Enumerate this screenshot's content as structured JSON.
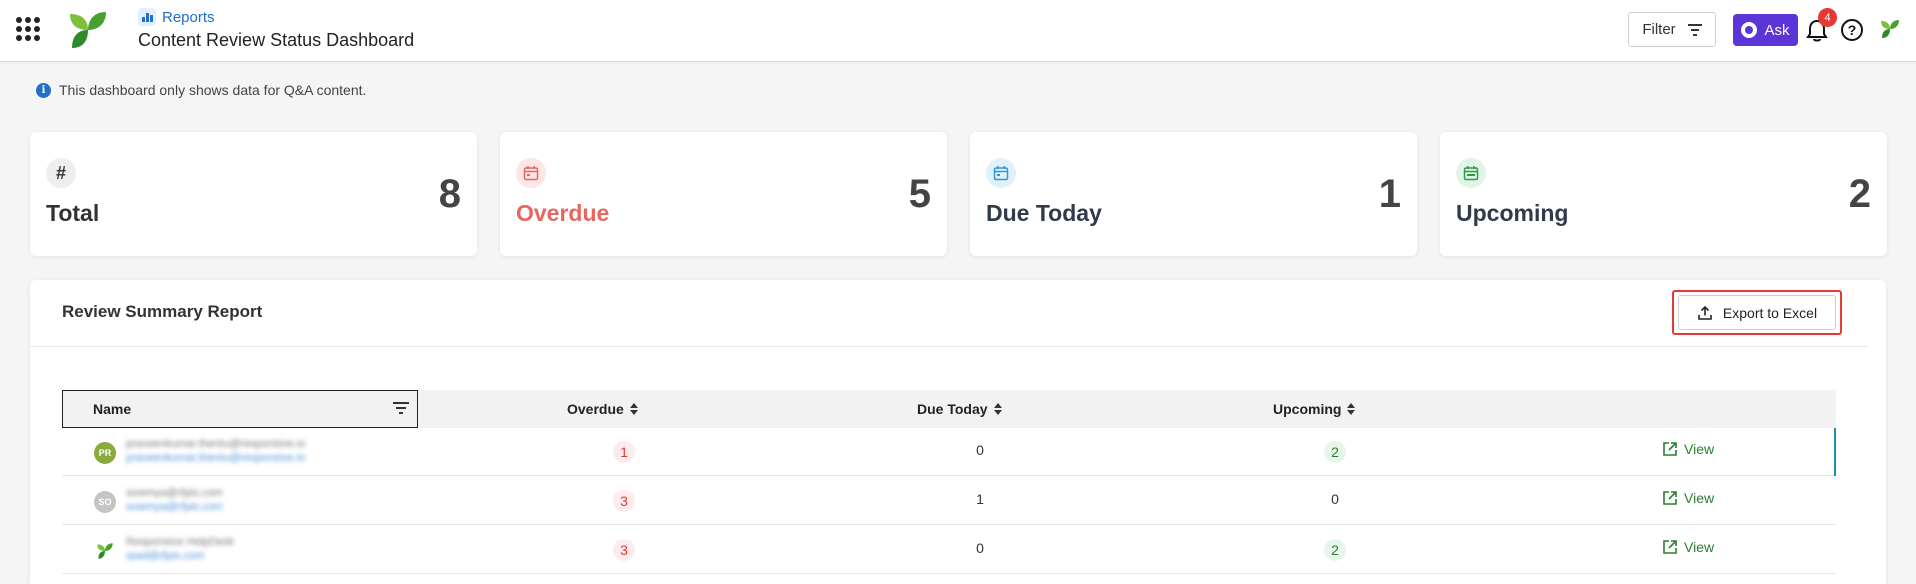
{
  "header": {
    "breadcrumb": "Reports",
    "title": "Content Review Status Dashboard",
    "filter_label": "Filter",
    "ask_label": "Ask",
    "notification_count": "4",
    "help_glyph": "?"
  },
  "info": {
    "glyph": "i",
    "text": "This dashboard only shows data for Q&A content."
  },
  "stats": [
    {
      "label": "Total",
      "value": "8",
      "icon": "hash-icon",
      "icon_glyph": "#",
      "color": "#333333",
      "icon_bg": "#eeeeee"
    },
    {
      "label": "Overdue",
      "value": "5",
      "icon": "calendar-icon",
      "color": "#e5675f",
      "icon_bg": "#fde6e4"
    },
    {
      "label": "Due Today",
      "value": "1",
      "icon": "calendar-icon",
      "color": "#2f3a4a",
      "icon_bg": "#e1f1fb"
    },
    {
      "label": "Upcoming",
      "value": "2",
      "icon": "calendar-icon",
      "color": "#2f3a4a",
      "icon_bg": "#e2f4e6"
    }
  ],
  "summary": {
    "title": "Review Summary Report",
    "export_label": "Export to Excel",
    "columns": {
      "name": "Name",
      "overdue": "Overdue",
      "due_today": "Due Today",
      "upcoming": "Upcoming"
    },
    "view_label": "View",
    "rows": [
      {
        "initials": "PR",
        "name": "praveenkumar.thentu@responsive.io",
        "email": "praveenkumar.thentu@responsive.io",
        "overdue": "1",
        "due_today": "0",
        "upcoming": "2",
        "avatar_color": "#8aaa3c"
      },
      {
        "initials": "SO",
        "name": "sowmya@rfpio.com",
        "email": "sowmya@rfpio.com",
        "overdue": "3",
        "due_today": "1",
        "upcoming": "0",
        "avatar_color": "#c4c4c4"
      },
      {
        "initials": "",
        "name": "Responsive HelpDesk",
        "email": "rpad@rfpio.com",
        "overdue": "3",
        "due_today": "0",
        "upcoming": "2",
        "avatar_color": "#ffffff"
      }
    ]
  },
  "colors": {
    "accent": "#5b35d6",
    "link": "#1e6fd1",
    "danger": "#e53935",
    "success": "#2e7d32"
  }
}
